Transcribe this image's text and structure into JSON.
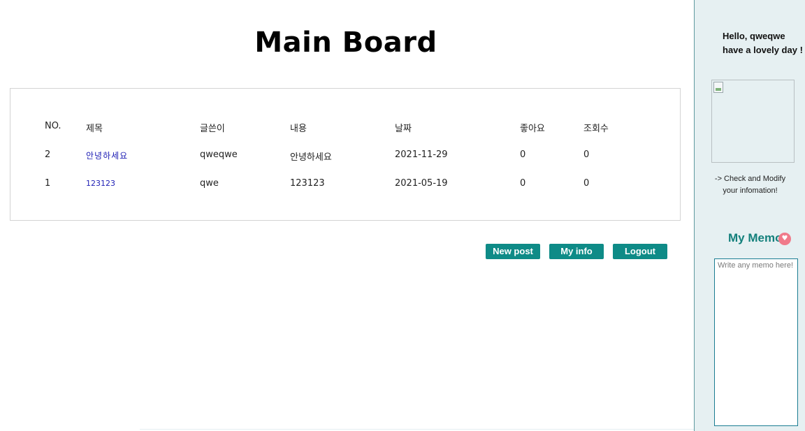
{
  "page": {
    "title": "Main Board"
  },
  "board": {
    "columns": {
      "no": "NO.",
      "title": "제목",
      "author": "글쓴이",
      "content": "내용",
      "date": "날짜",
      "likes": "좋아요",
      "views": "조회수"
    },
    "rows": [
      {
        "no": "2",
        "title": "안녕하세요",
        "author": "qweqwe",
        "content": "안녕하세요",
        "date": "2021-11-29",
        "likes": "0",
        "views": "0"
      },
      {
        "no": "1",
        "title": "123123",
        "author": "qwe",
        "content": "123123",
        "date": "2021-05-19",
        "likes": "0",
        "views": "0"
      }
    ]
  },
  "actions": {
    "new_post": "New post",
    "my_info": "My info",
    "logout": "Logout"
  },
  "sidebar": {
    "greeting_line1": "Hello, qweqwe",
    "greeting_line2": "have a lovely day !",
    "check_line1": "-> Check and Modify",
    "check_line2": "your infomation!",
    "memo_title": "My Memo",
    "memo_icon": "heart-icon",
    "memo_placeholder": "Write any memo here!"
  },
  "colors": {
    "accent": "#0e8b87",
    "sidebar_bg": "#e6f0f2",
    "link": "#1c1cb4",
    "heart": "#f07a8a"
  }
}
